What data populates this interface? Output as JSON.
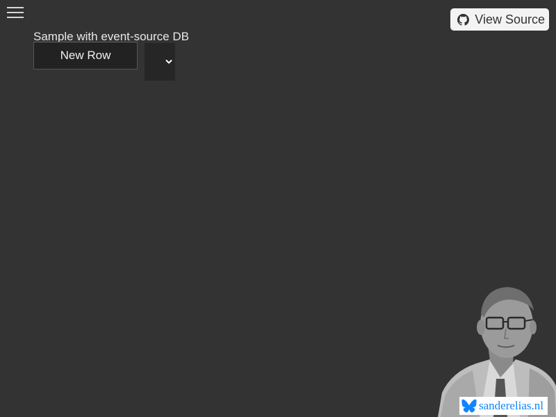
{
  "header": {
    "view_source_label": "View Source",
    "menu_icon": "hamburger-menu-icon",
    "source_icon": "github-icon"
  },
  "main": {
    "title": "Sample with event-source DB",
    "new_row_label": "New Row",
    "select": {
      "selected_value": ""
    }
  },
  "footer": {
    "site_label": "sanderelias.nl",
    "site_icon": "bluesky-butterfly-icon",
    "accent_color": "#1185fe"
  },
  "colors": {
    "background": "#333333",
    "text": "#e8e8e8",
    "button_bg": "#222222"
  }
}
